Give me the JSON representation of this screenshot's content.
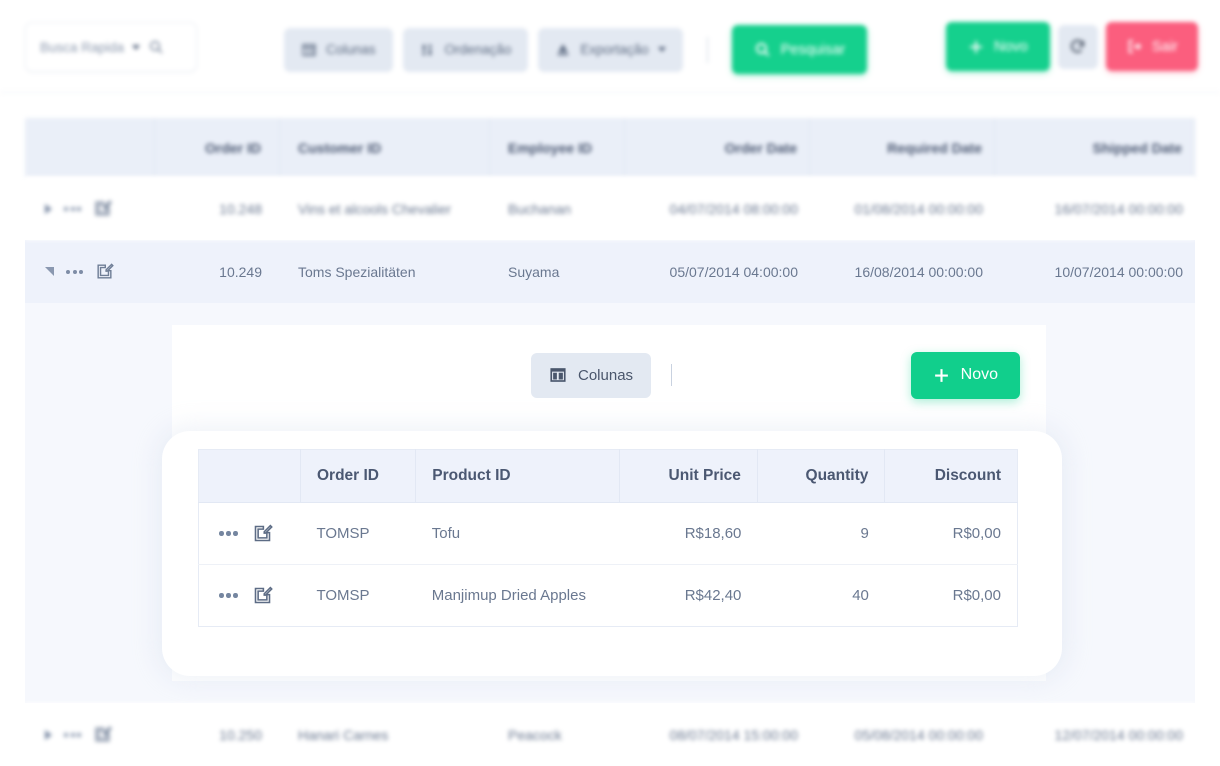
{
  "toolbar": {
    "quick_search": {
      "label": "Busca Rapida",
      "placeholder": "Busca Rapida",
      "dropdown_icon": "chevron-down-icon",
      "search_icon": "magnifier-icon"
    },
    "buttons": [
      {
        "label": "Colunas",
        "icon": "columns-icon"
      },
      {
        "label": "Ordenação",
        "icon": "sort-icon"
      },
      {
        "label": "Exportação",
        "icon": "export-icon",
        "has_caret": true
      }
    ],
    "search_label": "Pesquisar",
    "search_icon": "magnifier-icon",
    "new_label": "Novo",
    "new_icon": "plus-icon",
    "refresh_icon": "refresh-icon",
    "exit_label": "Sair",
    "exit_icon": "logout-icon"
  },
  "colors": {
    "green": "#15d08d",
    "pink": "#fb5e7e",
    "soft_button": "#e3e9f2",
    "header_bg": "#eaeff8",
    "row_alt": "#eef2fb",
    "detail_bg": "#f6f8fd",
    "text": "#6a7890"
  },
  "orders_grid": {
    "columns": [
      "",
      "Order ID",
      "Customer ID",
      "Employee ID",
      "Order Date",
      "Required Date",
      "Shipped Date"
    ],
    "rows": [
      {
        "expanded": false,
        "order_id": "10.248",
        "customer_id": "Vins et alcools Chevalier",
        "employee_id": "Buchanan",
        "order_date": "04/07/2014 08:00:00",
        "required_date": "01/08/2014 00:00:00",
        "shipped_date": "16/07/2014 00:00:00"
      },
      {
        "expanded": true,
        "order_id": "10.249",
        "customer_id": "Toms Spezialitäten",
        "employee_id": "Suyama",
        "order_date": "05/07/2014 04:00:00",
        "required_date": "16/08/2014 00:00:00",
        "shipped_date": "10/07/2014 00:00:00"
      },
      {
        "expanded": false,
        "order_id": "10.250",
        "customer_id": "Hanari Carnes",
        "employee_id": "Peacock",
        "order_date": "08/07/2014 15:00:00",
        "required_date": "05/08/2014 00:00:00",
        "shipped_date": "12/07/2014 00:00:00"
      }
    ],
    "row_icons": {
      "expand": "triangle-right-icon",
      "collapse": "triangle-down-icon",
      "menu": "ellipsis-icon",
      "edit": "edit-pencil-icon"
    }
  },
  "detail_panel": {
    "toolbar": {
      "columns_label": "Colunas",
      "columns_icon": "columns-icon",
      "new_label": "Novo",
      "new_icon": "plus-icon"
    },
    "columns": [
      "",
      "Order ID",
      "Product ID",
      "Unit Price",
      "Quantity",
      "Discount"
    ],
    "rows": [
      {
        "order_id": "TOMSP",
        "product_id": "Tofu",
        "unit_price": "R$18,60",
        "quantity": "9",
        "discount": "R$0,00"
      },
      {
        "order_id": "TOMSP",
        "product_id": "Manjimup Dried Apples",
        "unit_price": "R$42,40",
        "quantity": "40",
        "discount": "R$0,00"
      }
    ]
  }
}
